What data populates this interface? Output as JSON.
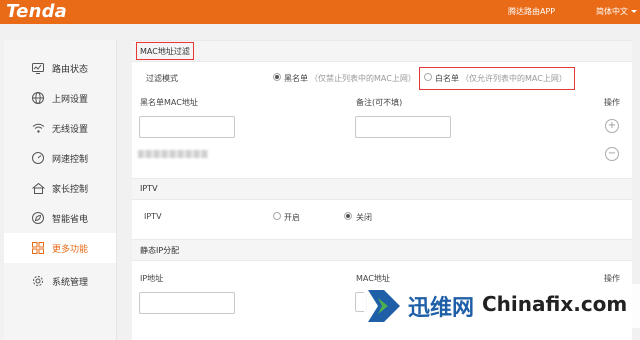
{
  "header": {
    "logo": "Tenda",
    "app_link": "腾达路由APP",
    "language": "简体中文"
  },
  "sidebar": {
    "items": [
      {
        "label": "路由状态",
        "icon": "monitor-icon"
      },
      {
        "label": "上网设置",
        "icon": "globe-icon"
      },
      {
        "label": "无线设置",
        "icon": "wifi-icon"
      },
      {
        "label": "网速控制",
        "icon": "gauge-icon"
      },
      {
        "label": "家长控制",
        "icon": "house-icon"
      },
      {
        "label": "智能省电",
        "icon": "leaf-icon"
      },
      {
        "label": "更多功能",
        "icon": "grid-icon",
        "active": true
      },
      {
        "label": "系统管理",
        "icon": "gear-icon"
      }
    ]
  },
  "mac_filter": {
    "title": "MAC地址过滤",
    "mode_label": "过滤模式",
    "blacklist_label": "黑名单",
    "blacklist_hint": "（仅禁止列表中的MAC上网）",
    "whitelist_label": "白名单",
    "whitelist_hint": "（仅允许列表中的MAC上网）",
    "selected_mode": "黑名单",
    "col_mac": "黑名单MAC地址",
    "col_remark": "备注(可不填)",
    "col_action": "操作",
    "mac_input": "",
    "remark_input": ""
  },
  "iptv": {
    "title": "IPTV",
    "label": "IPTV",
    "on_label": "开启",
    "off_label": "关闭",
    "selected": "关闭"
  },
  "static_ip": {
    "title": "静态IP分配",
    "col_ip": "IP地址",
    "col_mac": "MAC地址",
    "col_action": "操作",
    "ip_input": ""
  },
  "watermark": {
    "cn_text": "迅维网",
    "en_text": "Chinafix.com"
  },
  "colors": {
    "accent": "#e96a17",
    "highlight_border": "#e53935",
    "watermark_blue": "#1f5fa8"
  }
}
